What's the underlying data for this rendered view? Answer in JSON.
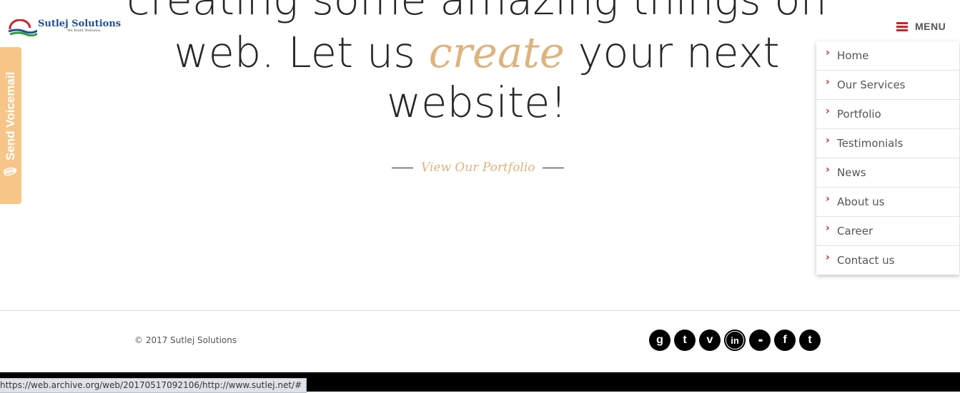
{
  "logo": {
    "name": "Sutlej Solutions",
    "tagline": "We Build Websites"
  },
  "voicemail": {
    "label": "Send Voicemail",
    "icon": "microphone-icon",
    "color": "#f8c589"
  },
  "hero": {
    "line1": "creating some amazing things on",
    "line2_prefix": "web. Let us ",
    "line2_emphasis": "create",
    "line2_suffix": " your next",
    "line3": "website!",
    "accent_color": "#deb37d"
  },
  "portfolio_link": "View Our Portfolio",
  "menu": {
    "label": "MENU",
    "accent_color": "#d21f2a",
    "items": [
      {
        "label": "Home"
      },
      {
        "label": "Our Services"
      },
      {
        "label": "Portfolio"
      },
      {
        "label": "Testimonials"
      },
      {
        "label": "News"
      },
      {
        "label": "About us"
      },
      {
        "label": "Career"
      },
      {
        "label": "Contact us"
      }
    ]
  },
  "footer": {
    "copyright": "© 2017 Sutlej Solutions",
    "social": [
      {
        "name": "google-plus-icon",
        "glyph": "g"
      },
      {
        "name": "tumblr-icon",
        "glyph": "t"
      },
      {
        "name": "vimeo-icon",
        "glyph": "v"
      },
      {
        "name": "linkedin-icon",
        "glyph": "in"
      },
      {
        "name": "flickr-icon",
        "glyph": "••"
      },
      {
        "name": "facebook-icon",
        "glyph": "f"
      },
      {
        "name": "twitter-icon",
        "glyph": "t"
      }
    ]
  },
  "status_url": "https://web.archive.org/web/20170517092106/http://www.sutlej.net/#"
}
